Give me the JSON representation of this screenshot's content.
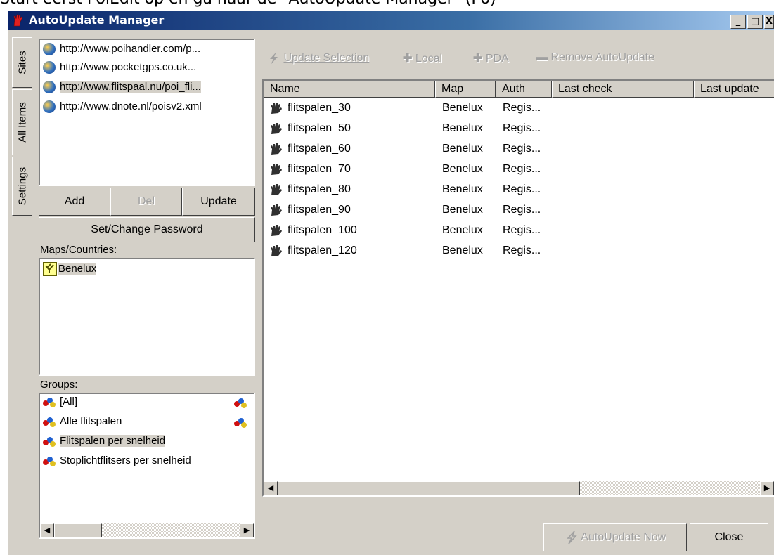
{
  "caption": "Start eerst PoiEdit op en ga naar de \"AutoUpdate Manager\" (F6)",
  "window": {
    "title": "AutoUpdate Manager",
    "controls": {
      "minimize": "_",
      "maximize": "□",
      "close": "X"
    }
  },
  "vertical_tabs": [
    {
      "label": "Sites",
      "active": true
    },
    {
      "label": "All Items",
      "active": false
    },
    {
      "label": "Settings",
      "active": false
    }
  ],
  "sites": [
    {
      "url": "http://www.poihandler.com/p...",
      "selected": false
    },
    {
      "url": "http://www.pocketgps.co.uk...",
      "selected": false
    },
    {
      "url": "http://www.flitspaal.nu/poi_fli...",
      "selected": true
    },
    {
      "url": "http://www.dnote.nl/poisv2.xml",
      "selected": false
    }
  ],
  "site_buttons": {
    "add": "Add",
    "del": "Del",
    "update": "Update",
    "password": "Set/Change Password"
  },
  "maps": {
    "label": "Maps/Countries:",
    "items": [
      {
        "name": "Benelux",
        "selected": true
      }
    ]
  },
  "groups": {
    "label": "Groups:",
    "items": [
      {
        "name": "[All]",
        "selected": false
      },
      {
        "name": "Alle flitspalen",
        "selected": false
      },
      {
        "name": "Flitspalen per snelheid",
        "selected": true
      },
      {
        "name": "Stoplichtflitsers per snelheid",
        "selected": false
      }
    ]
  },
  "toolbar": {
    "update_selection": "Update Selection",
    "local": "Local",
    "pda": "PDA",
    "remove": "Remove AutoUpdate"
  },
  "table": {
    "columns": [
      "Name",
      "Map",
      "Auth",
      "Last check",
      "Last update"
    ],
    "rows": [
      {
        "name": "flitspalen_30",
        "map": "Benelux",
        "auth": "Regis..."
      },
      {
        "name": "flitspalen_50",
        "map": "Benelux",
        "auth": "Regis..."
      },
      {
        "name": "flitspalen_60",
        "map": "Benelux",
        "auth": "Regis..."
      },
      {
        "name": "flitspalen_70",
        "map": "Benelux",
        "auth": "Regis..."
      },
      {
        "name": "flitspalen_80",
        "map": "Benelux",
        "auth": "Regis..."
      },
      {
        "name": "flitspalen_90",
        "map": "Benelux",
        "auth": "Regis..."
      },
      {
        "name": "flitspalen_100",
        "map": "Benelux",
        "auth": "Regis..."
      },
      {
        "name": "flitspalen_120",
        "map": "Benelux",
        "auth": "Regis..."
      }
    ]
  },
  "footer": {
    "autoupdate_now": "AutoUpdate Now",
    "close": "Close"
  },
  "colors": {
    "face": "#d4d0c8",
    "title_start": "#0a246a",
    "title_end": "#a6caf0",
    "disabled_text": "#a0a0a0"
  }
}
